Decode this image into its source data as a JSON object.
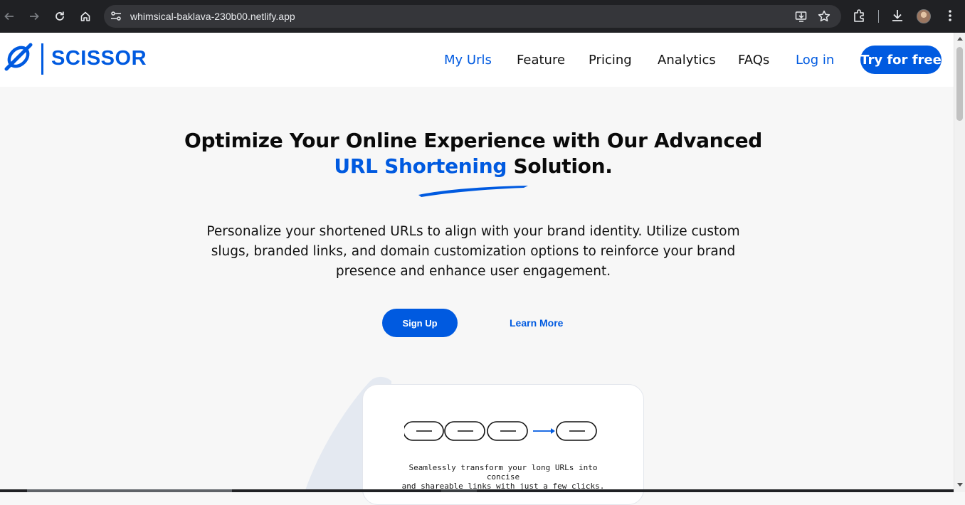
{
  "browser": {
    "url": "whimsical-baklava-230b00.netlify.app",
    "icons": [
      "back-icon",
      "forward-icon",
      "reload-icon",
      "home-icon",
      "site-info-icon",
      "install-app-icon",
      "bookmark-star-icon",
      "extensions-icon",
      "downloads-icon",
      "profile-avatar",
      "more-menu-icon"
    ]
  },
  "site": {
    "brand": "SCISSOR",
    "nav": {
      "my_urls": "My Urls",
      "feature": "Feature",
      "pricing": "Pricing",
      "analytics": "Analytics",
      "faqs": "FAQs",
      "login": "Log in",
      "try_free": "Try for free"
    }
  },
  "hero": {
    "title_line1": "Optimize Your Online Experience with Our Advanced",
    "title_accent": "URL Shortening",
    "title_end": " Solution.",
    "description": "Personalize your shortened URLs to align with your brand identity. Utilize custom slugs, branded links, and domain customization options to reinforce your brand presence and enhance user engagement.",
    "signup": "Sign Up",
    "learn_more": "Learn More"
  },
  "card": {
    "caption_line1": "Seamlessly transform your long URLs into concise",
    "caption_line2": "and shareable links with just a few clicks."
  },
  "colors": {
    "brand": "#005ae0",
    "chrome_bg": "#202124",
    "page_bg": "#f7f7f7"
  }
}
